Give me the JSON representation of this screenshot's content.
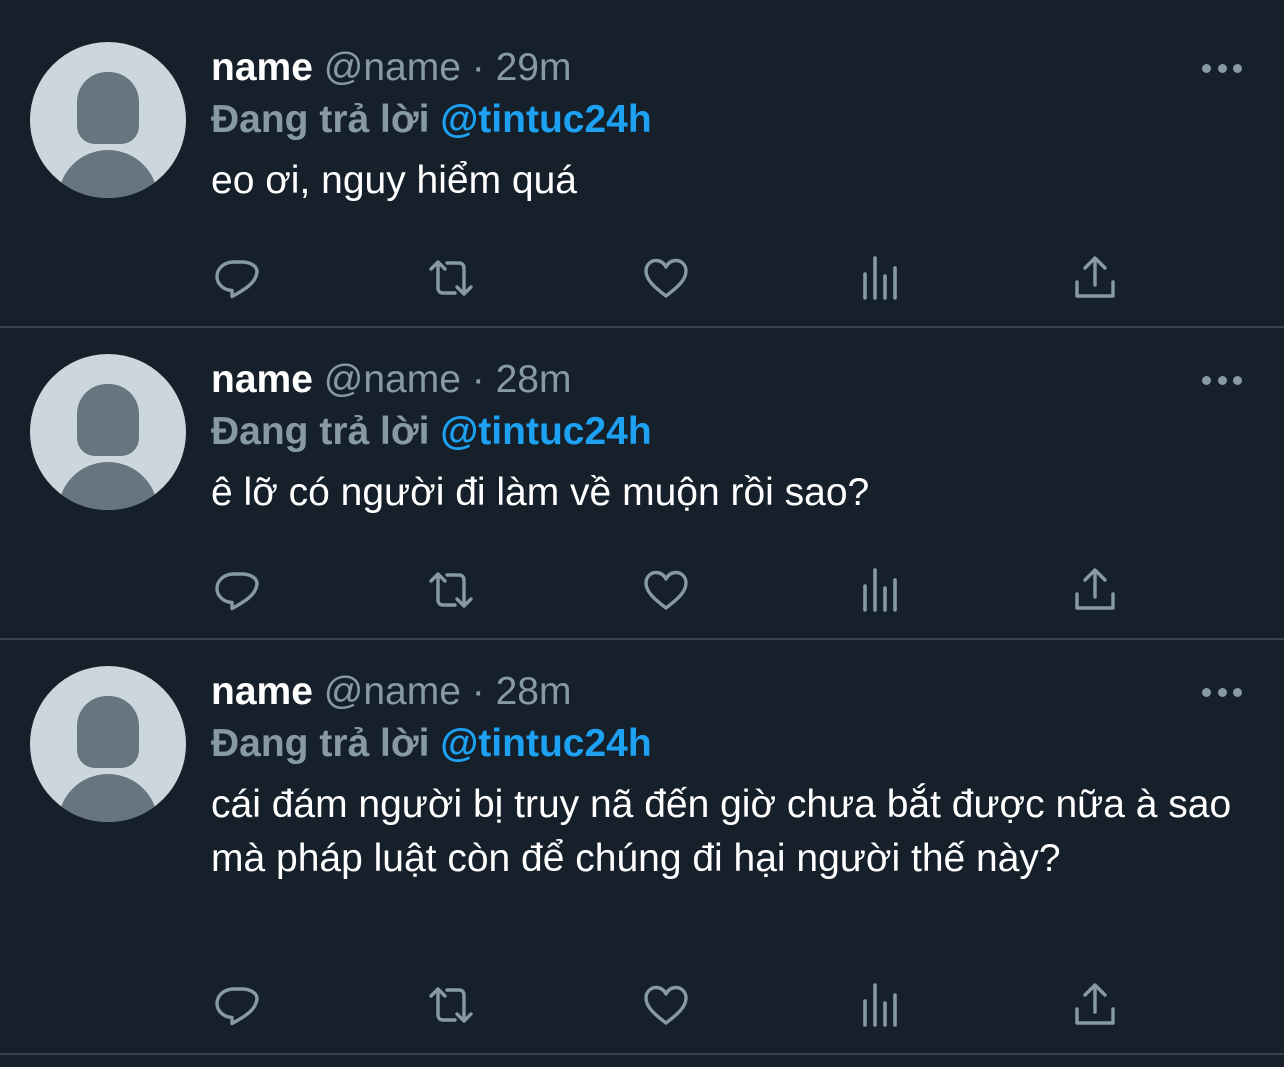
{
  "colors": {
    "background": "#15202b",
    "divider": "#38444d",
    "secondary_text": "#8899a6",
    "mention": "#1da1f2",
    "avatar_bg": "#ccd6dd",
    "avatar_fg": "#66757f"
  },
  "tweets": [
    {
      "display_name": "name",
      "handle": "@name",
      "separator": "·",
      "time": "29m",
      "reply_prefix": "Đang trả lời",
      "reply_to": "@tintuc24h",
      "text": "eo ơi, nguy hiểm quá"
    },
    {
      "display_name": "name",
      "handle": "@name",
      "separator": "·",
      "time": "28m",
      "reply_prefix": "Đang trả lời",
      "reply_to": "@tintuc24h",
      "text": "ê lỡ có người đi làm về muộn rồi sao?"
    },
    {
      "display_name": "name",
      "handle": "@name",
      "separator": "·",
      "time": "28m",
      "reply_prefix": "Đang trả lời",
      "reply_to": "@tintuc24h",
      "text": "cái đám người bị truy nã đến giờ chưa bắt được nữa à sao mà pháp luật còn để chúng đi hại người thế này?"
    }
  ],
  "action_icons": [
    "reply-icon",
    "retweet-icon",
    "like-icon",
    "analytics-icon",
    "share-icon"
  ]
}
